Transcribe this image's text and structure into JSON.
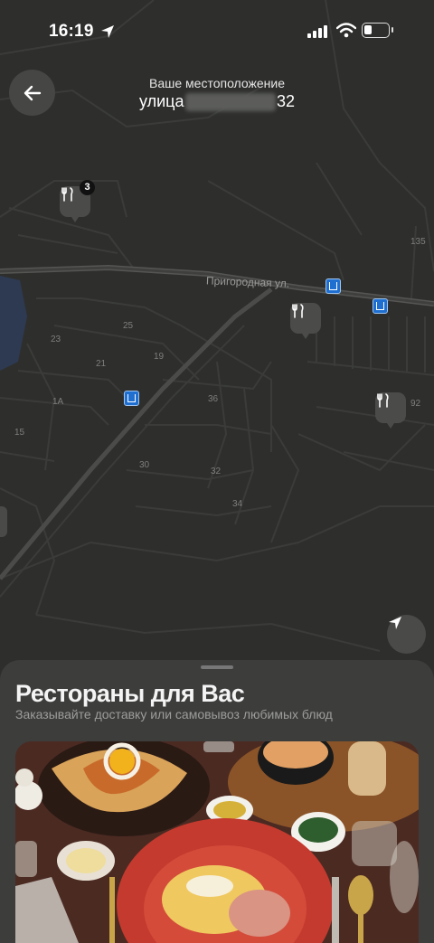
{
  "status_bar": {
    "time": "16:19"
  },
  "header": {
    "label": "Ваше местоположение",
    "street": "улица",
    "house_number": "32"
  },
  "map": {
    "street_name": "Пригородная ул.",
    "cluster_count": "3",
    "house_numbers": [
      "135",
      "25",
      "23",
      "19",
      "21",
      "1А",
      "36",
      "92",
      "15",
      "30",
      "32",
      "34"
    ]
  },
  "sheet": {
    "title": "Рестораны для Вас",
    "subtitle": "Заказывайте доставку или самовывоз любимых блюд"
  }
}
